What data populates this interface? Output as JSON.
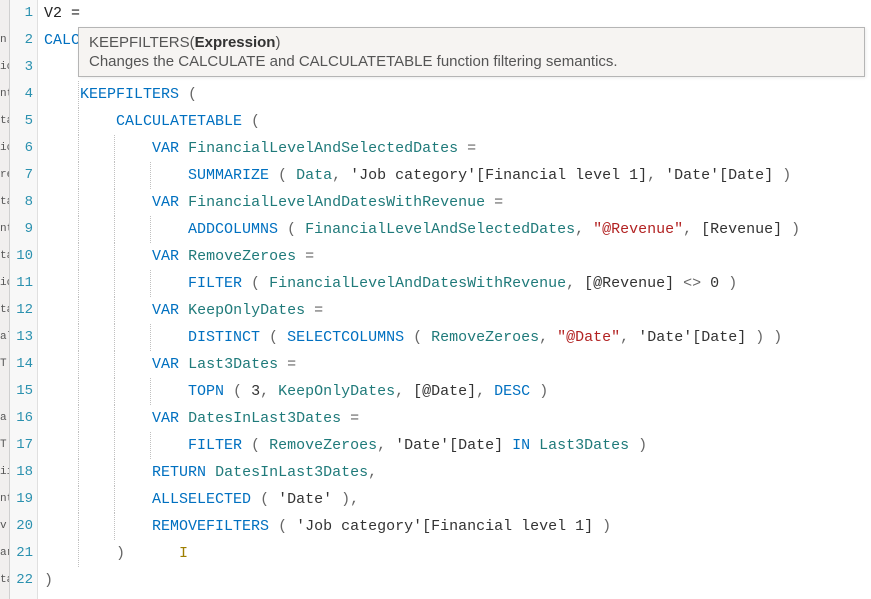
{
  "tooltip": {
    "sig_prefix": "KEEPFILTERS(",
    "sig_bold": "Expression",
    "sig_suffix": ")",
    "desc": "Changes the CALCULATE and CALCULATETABLE function filtering semantics."
  },
  "left_sliver": [
    "",
    "n",
    "ic",
    "nt",
    "ta",
    "ic",
    "re",
    "ta",
    "nt",
    "ta",
    "ic",
    "ta",
    "al",
    "T",
    "",
    "a",
    "T",
    "ii",
    "nt",
    "v",
    "ar",
    "ta"
  ],
  "line_numbers": [
    "1",
    "2",
    "3",
    "4",
    "5",
    "6",
    "7",
    "8",
    "9",
    "10",
    "11",
    "12",
    "13",
    "14",
    "15",
    "16",
    "17",
    "18",
    "19",
    "20",
    "21",
    "22"
  ],
  "code": {
    "l1": {
      "ident": "V2",
      "eq": " ="
    },
    "l2": {
      "prefix": "CALC"
    },
    "l3": {
      "text": ""
    },
    "l4": {
      "fn": "KEEPFILTERS",
      "paren": " ("
    },
    "l5": {
      "fn": "CALCULATETABLE",
      "paren": " ("
    },
    "l6": {
      "var": "VAR",
      "name": "FinancialLevelAndSelectedDates",
      "eq": " ="
    },
    "l7": {
      "fn": "SUMMARIZE",
      "open": " ( ",
      "tbl": "Data",
      "c1": ", ",
      "col1": "'Job category'[Financial level 1]",
      "c2": ", ",
      "col2": "'Date'[Date]",
      "close": " )"
    },
    "l8": {
      "var": "VAR",
      "name": "FinancialLevelAndDatesWithRevenue",
      "eq": " ="
    },
    "l9": {
      "fn": "ADDCOLUMNS",
      "open": " ( ",
      "arg1": "FinancialLevelAndSelectedDates",
      "c1": ", ",
      "str": "\"@Revenue\"",
      "c2": ", ",
      "meas": "[Revenue]",
      "close": " )"
    },
    "l10": {
      "var": "VAR",
      "name": "RemoveZeroes",
      "eq": " ="
    },
    "l11": {
      "fn": "FILTER",
      "open": " ( ",
      "arg1": "FinancialLevelAndDatesWithRevenue",
      "c1": ", ",
      "col": "[@Revenue]",
      "op": " <> ",
      "val": "0",
      "close": " )"
    },
    "l12": {
      "var": "VAR",
      "name": "KeepOnlyDates",
      "eq": " ="
    },
    "l13": {
      "fn1": "DISTINCT",
      "open1": " ( ",
      "fn2": "SELECTCOLUMNS",
      "open2": " ( ",
      "arg1": "RemoveZeroes",
      "c1": ", ",
      "str": "\"@Date\"",
      "c2": ", ",
      "col": "'Date'[Date]",
      "close": " ) )"
    },
    "l14": {
      "var": "VAR",
      "name": "Last3Dates",
      "eq": " ="
    },
    "l15": {
      "fn": "TOPN",
      "open": " ( ",
      "n": "3",
      "c1": ", ",
      "arg1": "KeepOnlyDates",
      "c2": ", ",
      "col": "[@Date]",
      "c3": ", ",
      "ord": "DESC",
      "close": " )"
    },
    "l16": {
      "var": "VAR",
      "name": "DatesInLast3Dates",
      "eq": " ="
    },
    "l17": {
      "fn": "FILTER",
      "open": " ( ",
      "arg1": "RemoveZeroes",
      "c1": ", ",
      "col": "'Date'[Date]",
      "in": " IN ",
      "arg2": "Last3Dates",
      "close": " )"
    },
    "l18": {
      "ret": "RETURN",
      "sp": " ",
      "name": "DatesInLast3Dates",
      "comma": ","
    },
    "l19": {
      "fn": "ALLSELECTED",
      "open": " ( ",
      "arg": "'Date'",
      "close": " ),"
    },
    "l20": {
      "fn": "REMOVEFILTERS",
      "open": " ( ",
      "arg": "'Job category'[Financial level 1]",
      "close": " )"
    },
    "l21": {
      "close": ")"
    },
    "l22": {
      "close": ")"
    }
  }
}
